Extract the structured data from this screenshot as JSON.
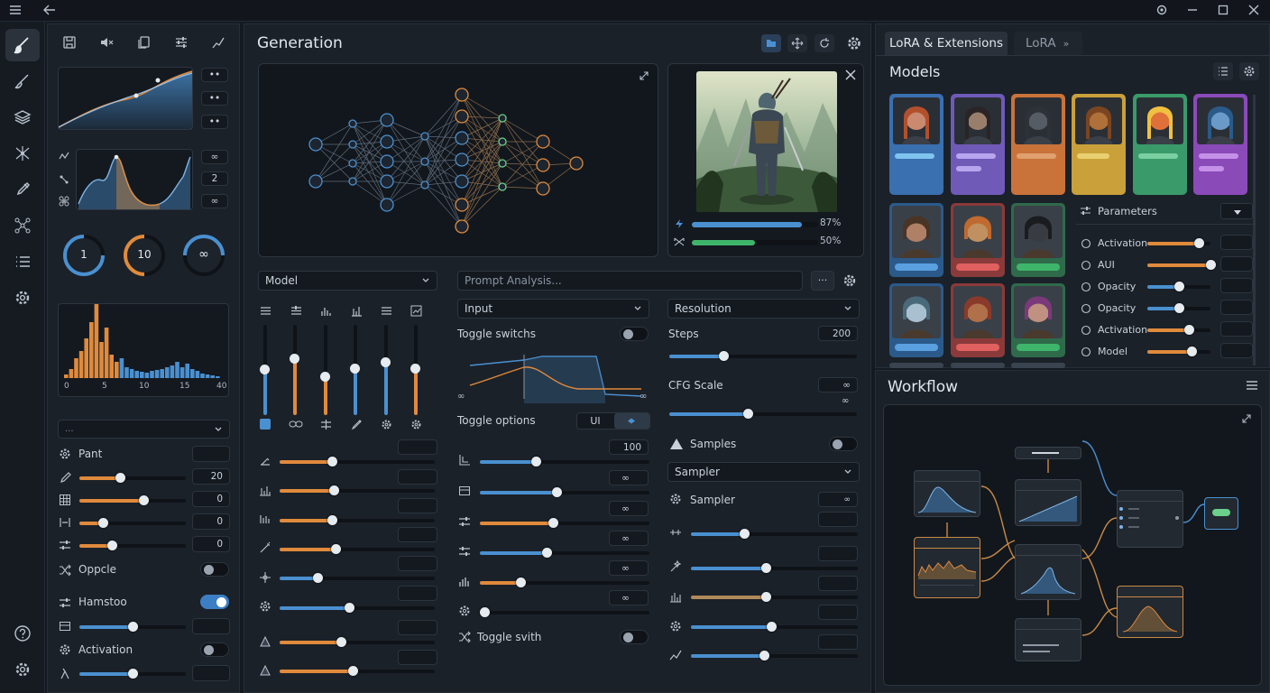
{
  "left_column": {
    "stepper_values": [
      "2",
      "∞"
    ],
    "knobs": [
      "1",
      "10",
      "∞"
    ],
    "histogram_axis": [
      "0",
      "5",
      "10",
      "15",
      "40"
    ],
    "dropdown_value": "...",
    "rows": {
      "pant": "Pant",
      "r1": "20",
      "r2": "0",
      "r3": "0",
      "r4": "0",
      "oppcle": "Oppcle",
      "hamstoo": "Hamstoo",
      "activation": "Activation"
    }
  },
  "generation": {
    "title": "Generation",
    "model_select": "Model",
    "prompt_placeholder": "Prompt Analysis...",
    "more_label": "···",
    "input_select": "Input",
    "toggle_switchs": "Toggle switchs",
    "curve_min": "∞",
    "curve_max": "∞",
    "toggle_options": "Toggle options",
    "seg_ui": "UI",
    "toggle_svith": "Toggle svith",
    "mid_values": [
      "100",
      "∞",
      "∞",
      "∞",
      "∞",
      "∞"
    ],
    "resolution_select": "Resolution",
    "steps_label": "Steps",
    "steps_value": "200",
    "cfg_label": "CFG Scale",
    "cfg_value": "∞",
    "cfg_sub": "∞",
    "samples_label": "Samples",
    "sampler_select": "Sampler",
    "sampler_label": "Sampler",
    "sampler_value": "∞",
    "progress": [
      {
        "value": 0.87,
        "label": "87%"
      },
      {
        "value": 0.5,
        "label": "50%"
      }
    ]
  },
  "right": {
    "tab_active": "LoRA & Extensions",
    "tab_other": "LoRA",
    "tab_other_suffix": "»",
    "models_title": "Models",
    "parameters_title": "Parameters",
    "params": [
      {
        "label": "Activation",
        "value": 0.82
      },
      {
        "label": "AUI",
        "value": 1.0
      },
      {
        "label": "Opacity",
        "value": 0.5
      },
      {
        "label": "Opacity",
        "value": 0.5
      },
      {
        "label": "Activation",
        "value": 0.65
      },
      {
        "label": "Model",
        "value": 0.7
      }
    ],
    "workflow_title": "Workflow"
  },
  "colors": {
    "accent_blue": "#4a90d0",
    "accent_orange": "#e08a3c",
    "accent_green": "#3fb56b",
    "bg": "#151a21"
  }
}
